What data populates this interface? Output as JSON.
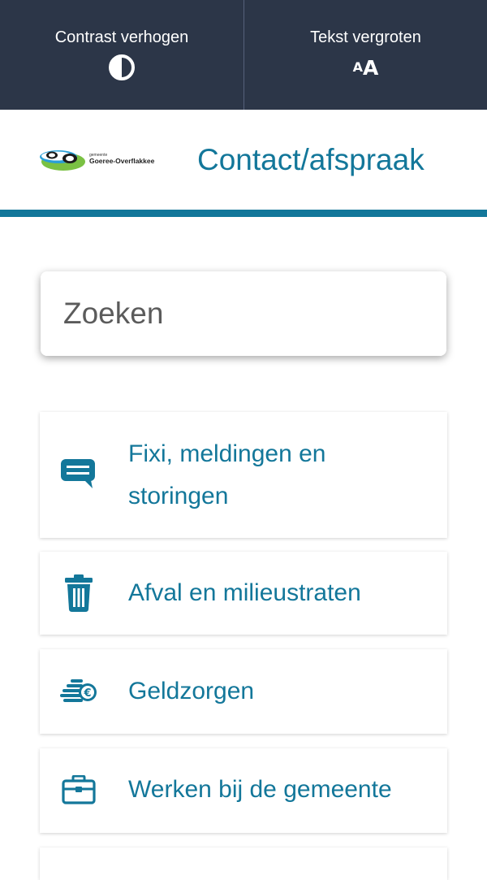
{
  "accessibility": {
    "contrast_label": "Contrast verhogen",
    "contrast_icon": "contrast-icon",
    "text_size_label": "Tekst vergroten",
    "text_size_icon": "text-size-icon",
    "aa_small": "A",
    "aa_large": "A"
  },
  "header": {
    "logo_tagline": "gemeente",
    "logo_name": "Goeree-Overflakkee",
    "contact_link": "Contact/afspraak"
  },
  "search": {
    "placeholder": "Zoeken",
    "value": "",
    "button_icon": "search-icon"
  },
  "cards": [
    {
      "label": "Fixi, meldingen en storingen",
      "icon": "chat-icon"
    },
    {
      "label": "Afval en milieustraten",
      "icon": "trash-icon"
    },
    {
      "label": "Geldzorgen",
      "icon": "coins-euro-icon"
    },
    {
      "label": "Werken bij de gemeente",
      "icon": "briefcase-icon"
    }
  ],
  "colors": {
    "accent": "#13779a",
    "topbar": "#2c3648",
    "logo_green": "#7ac143",
    "logo_blue": "#2a9fd6"
  }
}
